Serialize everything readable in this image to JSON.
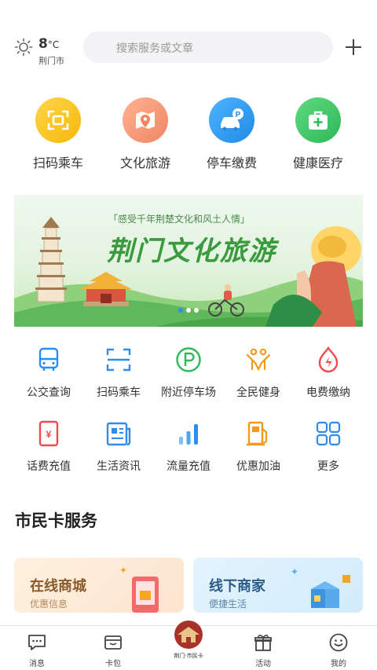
{
  "header": {
    "temperature": "8",
    "temperature_unit": "°C",
    "city": "荆门市",
    "search_placeholder": "搜索服务或文章"
  },
  "top_services": [
    {
      "label": "扫码乘车",
      "icon": "scan-icon",
      "color": "#f5b80b"
    },
    {
      "label": "文化旅游",
      "icon": "map-pin-icon",
      "color": "#f2946f"
    },
    {
      "label": "停车缴费",
      "icon": "parking-car-icon",
      "color": "#2d9bef"
    },
    {
      "label": "健康医疗",
      "icon": "medical-kit-icon",
      "color": "#3dbf5e"
    }
  ],
  "banner": {
    "tagline": "「感受千年荆楚文化和风土人情」",
    "title": "荆门文化旅游"
  },
  "grid_services": [
    {
      "label": "公交查询",
      "icon": "bus-icon"
    },
    {
      "label": "扫码乘车",
      "icon": "scan-frame-icon"
    },
    {
      "label": "附近停车场",
      "icon": "parking-icon"
    },
    {
      "label": "全民健身",
      "icon": "fitness-icon"
    },
    {
      "label": "电费缴纳",
      "icon": "electricity-icon"
    },
    {
      "label": "话费充值",
      "icon": "phone-bill-icon"
    },
    {
      "label": "生活资讯",
      "icon": "news-icon"
    },
    {
      "label": "流量充值",
      "icon": "data-signal-icon"
    },
    {
      "label": "优惠加油",
      "icon": "fuel-icon"
    },
    {
      "label": "更多",
      "icon": "more-grid-icon"
    }
  ],
  "section": {
    "title": "市民卡服务"
  },
  "cards": [
    {
      "title": "在线商城",
      "subtitle": "优惠信息"
    },
    {
      "title": "线下商家",
      "subtitle": "便捷生活"
    }
  ],
  "tabbar": {
    "items": [
      {
        "label": "消息",
        "icon": "message-icon"
      },
      {
        "label": "卡包",
        "icon": "wallet-icon"
      },
      {
        "label": "活动",
        "icon": "gift-icon"
      },
      {
        "label": "我的",
        "icon": "smile-icon"
      }
    ],
    "center_logo_text": "荆门·市民卡"
  },
  "colors": {
    "accent_blue": "#2d8cf0",
    "accent_orange": "#f39a1e",
    "accent_green": "#2fb85a",
    "accent_red": "#f04a4a"
  }
}
